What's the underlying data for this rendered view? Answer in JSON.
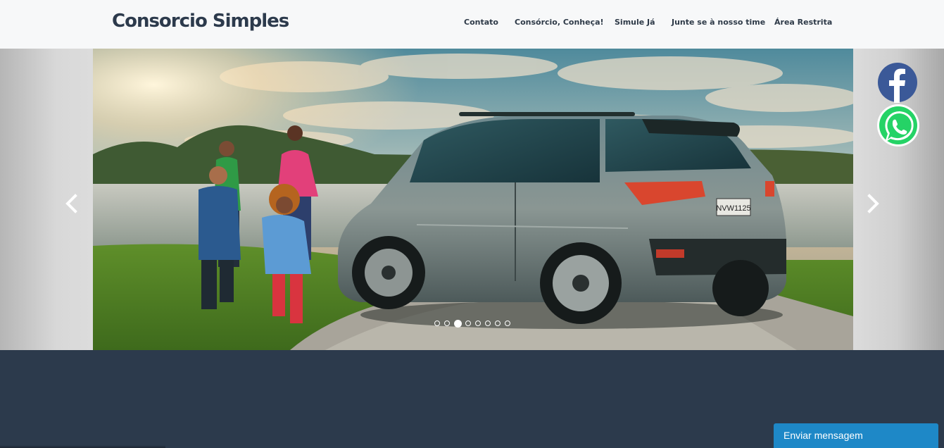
{
  "header": {
    "brand": "Consorcio Simples",
    "nav": [
      {
        "label": "Contato",
        "icon": ""
      },
      {
        "label": "Consórcio, Conheça!",
        "icon": ""
      },
      {
        "label": "Simule Já",
        "icon": ""
      },
      {
        "label": "Junte se à nosso time",
        "icon": ""
      },
      {
        "label": "Área Restrita",
        "icon": ""
      }
    ]
  },
  "carousel": {
    "slide_image": "family-and-suv-photo",
    "prev_icon": "chevron-left-icon",
    "next_icon": "chevron-right-icon",
    "indicator_count": 8,
    "active_indicator": 3,
    "license_plate": "NVW1125"
  },
  "social": {
    "facebook_icon": "facebook-icon",
    "whatsapp_icon": "whatsapp-icon"
  },
  "chat": {
    "label": "Enviar mensagem"
  },
  "colors": {
    "header_bg": "#f7f8f9",
    "brand_text": "#2c3a4c",
    "page_bg": "#2c3a4c",
    "chat_bg": "#1e88c7",
    "facebook_blue": "#3b5998",
    "whatsapp_green": "#25d366"
  }
}
